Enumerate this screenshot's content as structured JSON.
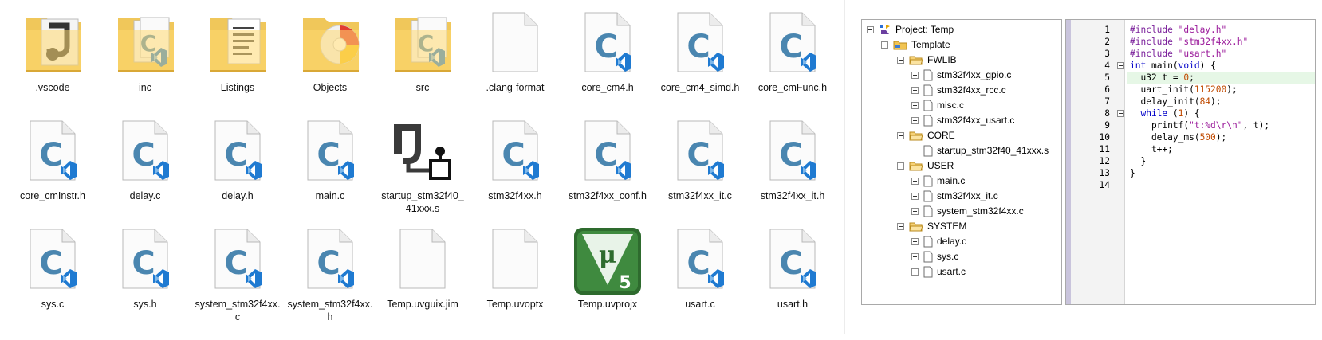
{
  "explorer": {
    "items": [
      {
        "name": ".vscode",
        "icon": "folder-vscode-icon"
      },
      {
        "name": "inc",
        "icon": "folder-c-icon"
      },
      {
        "name": "Listings",
        "icon": "folder-documents-icon"
      },
      {
        "name": "Objects",
        "icon": "folder-objects-icon"
      },
      {
        "name": "src",
        "icon": "folder-c-icon"
      },
      {
        "name": ".clang-format",
        "icon": "blank-file-icon"
      },
      {
        "name": "core_cm4.h",
        "icon": "c-file-icon"
      },
      {
        "name": "core_cm4_simd.h",
        "icon": "c-file-icon"
      },
      {
        "name": "core_cmFunc.h",
        "icon": "c-file-icon"
      },
      {
        "name": "core_cmInstr.h",
        "icon": "c-file-icon"
      },
      {
        "name": "delay.c",
        "icon": "c-file-icon"
      },
      {
        "name": "delay.h",
        "icon": "c-file-icon"
      },
      {
        "name": "main.c",
        "icon": "c-file-icon"
      },
      {
        "name": "startup_stm32f40_41xxx.s",
        "icon": "assembly-file-icon"
      },
      {
        "name": "stm32f4xx.h",
        "icon": "c-file-icon"
      },
      {
        "name": "stm32f4xx_conf.h",
        "icon": "c-file-icon"
      },
      {
        "name": "stm32f4xx_it.c",
        "icon": "c-file-icon"
      },
      {
        "name": "stm32f4xx_it.h",
        "icon": "c-file-icon"
      },
      {
        "name": "sys.c",
        "icon": "c-file-icon"
      },
      {
        "name": "sys.h",
        "icon": "c-file-icon"
      },
      {
        "name": "system_stm32f4xx.c",
        "icon": "c-file-icon"
      },
      {
        "name": "system_stm32f4xx.h",
        "icon": "c-file-icon"
      },
      {
        "name": "Temp.uvguix.jim",
        "icon": "blank-file-icon"
      },
      {
        "name": "Temp.uvoptx",
        "icon": "blank-file-icon"
      },
      {
        "name": "Temp.uvprojx",
        "icon": "keil-uvision5-icon"
      },
      {
        "name": "usart.c",
        "icon": "c-file-icon"
      },
      {
        "name": "usart.h",
        "icon": "c-file-icon"
      }
    ]
  },
  "project_tree": {
    "root": "Project: Temp",
    "target": "Template",
    "groups": [
      {
        "name": "FWLIB",
        "files": [
          "stm32f4xx_gpio.c",
          "stm32f4xx_rcc.c",
          "misc.c",
          "stm32f4xx_usart.c"
        ],
        "expandable": [
          true,
          true,
          true,
          true
        ]
      },
      {
        "name": "CORE",
        "files": [
          "startup_stm32f40_41xxx.s"
        ],
        "expandable": [
          false
        ]
      },
      {
        "name": "USER",
        "files": [
          "main.c",
          "stm32f4xx_it.c",
          "system_stm32f4xx.c"
        ],
        "expandable": [
          true,
          true,
          true
        ]
      },
      {
        "name": "SYSTEM",
        "files": [
          "delay.c",
          "sys.c",
          "usart.c"
        ],
        "expandable": [
          true,
          true,
          true
        ]
      }
    ]
  },
  "editor": {
    "line_numbers": [
      "1",
      "2",
      "3",
      "4",
      "5",
      "6",
      "7",
      "8",
      "9",
      "10",
      "11",
      "12",
      "13",
      "14"
    ],
    "highlighted_line": 5,
    "colors": {
      "preprocessor": "#7a1f9a",
      "string": "#9b1b9b",
      "keyword": "#0000c8",
      "number": "#c04a00",
      "highlight": "#e6f7e6"
    },
    "lines": [
      [
        {
          "t": "#include ",
          "c": "pre"
        },
        {
          "t": "\"delay.h\"",
          "c": "str"
        }
      ],
      [
        {
          "t": "#include ",
          "c": "pre"
        },
        {
          "t": "\"stm32f4xx.h\"",
          "c": "str"
        }
      ],
      [
        {
          "t": "#include ",
          "c": "pre"
        },
        {
          "t": "\"usart.h\"",
          "c": "str"
        }
      ],
      [
        {
          "t": "int",
          "c": "kw"
        },
        {
          "t": " main(",
          "c": ""
        },
        {
          "t": "void",
          "c": "kw"
        },
        {
          "t": ") {",
          "c": ""
        }
      ],
      [
        {
          "t": "  u32 t = ",
          "c": ""
        },
        {
          "t": "0",
          "c": "num"
        },
        {
          "t": ";",
          "c": ""
        }
      ],
      [
        {
          "t": "  uart_init(",
          "c": ""
        },
        {
          "t": "115200",
          "c": "num"
        },
        {
          "t": ");",
          "c": ""
        }
      ],
      [
        {
          "t": "  delay_init(",
          "c": ""
        },
        {
          "t": "84",
          "c": "num"
        },
        {
          "t": ");",
          "c": ""
        }
      ],
      [
        {
          "t": "  ",
          "c": ""
        },
        {
          "t": "while",
          "c": "kw"
        },
        {
          "t": " (",
          "c": ""
        },
        {
          "t": "1",
          "c": "num"
        },
        {
          "t": ") {",
          "c": ""
        }
      ],
      [
        {
          "t": "    printf(",
          "c": ""
        },
        {
          "t": "\"t:%d\\r\\n\"",
          "c": "str"
        },
        {
          "t": ", t);",
          "c": ""
        }
      ],
      [
        {
          "t": "    delay_ms(",
          "c": ""
        },
        {
          "t": "500",
          "c": "num"
        },
        {
          "t": ");",
          "c": ""
        }
      ],
      [
        {
          "t": "    t++;",
          "c": ""
        }
      ],
      [
        {
          "t": "  }",
          "c": ""
        }
      ],
      [
        {
          "t": "}",
          "c": ""
        }
      ],
      []
    ],
    "fold_markers_at": [
      4,
      8
    ]
  }
}
